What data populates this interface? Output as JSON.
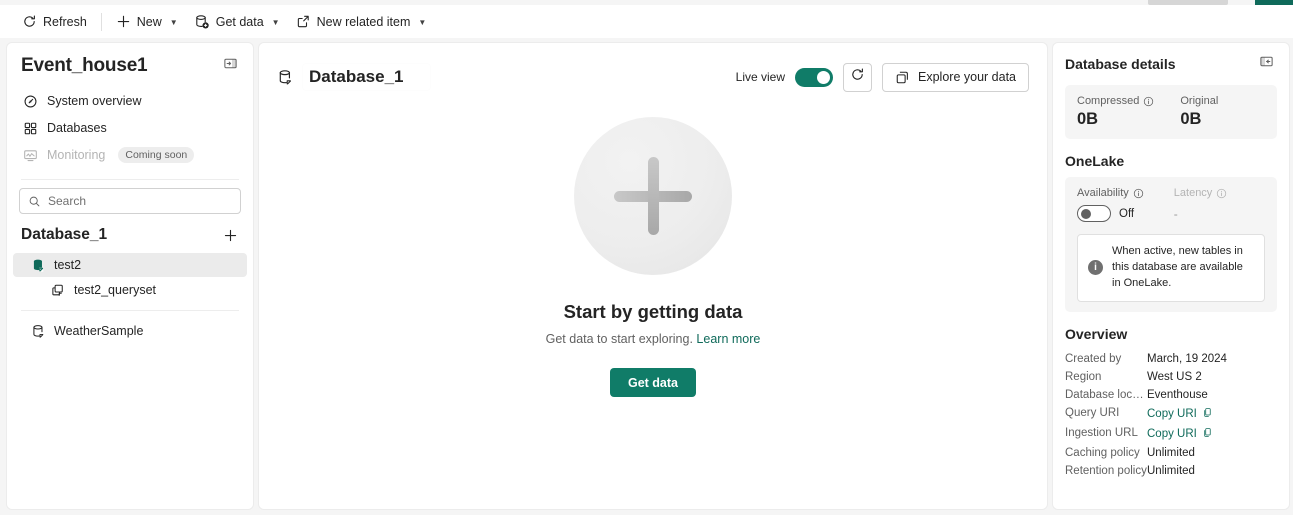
{
  "commandbar": {
    "items": [
      {
        "label": "Refresh",
        "icon": "refresh-icon",
        "chevron": false
      },
      {
        "label": "New",
        "icon": "plus-icon",
        "chevron": true
      },
      {
        "label": "Get data",
        "icon": "get-data-icon",
        "chevron": true
      },
      {
        "label": "New related item",
        "icon": "external-link-icon",
        "chevron": true
      }
    ]
  },
  "sidebar": {
    "title": "Event_house1",
    "collapse_tooltip": "Collapse pane",
    "nav": [
      {
        "label": "System overview",
        "icon": "gauge-icon",
        "disabled": false,
        "badge": ""
      },
      {
        "label": "Databases",
        "icon": "grid-icon",
        "disabled": false,
        "badge": ""
      },
      {
        "label": "Monitoring",
        "icon": "monitor-icon",
        "disabled": true,
        "badge": "Coming soon"
      }
    ],
    "search": {
      "placeholder": "Search",
      "value": ""
    },
    "db_header": "Database_1",
    "add_tooltip": "Add",
    "tree": [
      {
        "label": "test2",
        "icon": "database-icon",
        "selected": true,
        "indent": 0
      },
      {
        "label": "test2_queryset",
        "icon": "queryset-icon",
        "selected": false,
        "indent": 1
      }
    ],
    "tree_footer": [
      {
        "label": "WeatherSample",
        "icon": "database-icon",
        "selected": false,
        "indent": 0
      }
    ]
  },
  "main": {
    "title": "Database_1",
    "title_icon": "database-icon",
    "live_view_label": "Live view",
    "live_view_on": true,
    "refresh_tooltip": "Refresh",
    "explore_label": "Explore your data",
    "explore_icon": "explore-icon",
    "empty": {
      "plus_icon": "plus-icon",
      "title": "Start by getting data",
      "subtitle": "Get data to start exploring.",
      "link": "Learn more",
      "button": "Get data"
    }
  },
  "rightpanel": {
    "title": "Database details",
    "collapse_tooltip": "Collapse pane",
    "stats": [
      {
        "label": "Compressed",
        "info": true,
        "value": "0B"
      },
      {
        "label": "Original",
        "info": false,
        "value": "0B"
      }
    ],
    "onelake": {
      "section_title": "OneLake",
      "availability_label": "Availability",
      "availability_state": "Off",
      "availability_on": false,
      "latency_label": "Latency",
      "latency_value": "-",
      "note": "When active, new tables in this database are available in OneLake."
    },
    "overview": {
      "section_title": "Overview",
      "rows": [
        {
          "key": "Created by",
          "value": "March, 19 2024",
          "type": "text"
        },
        {
          "key": "Region",
          "value": "West US 2",
          "type": "text"
        },
        {
          "key": "Database locati...",
          "value": "Eventhouse",
          "type": "text"
        },
        {
          "key": "Query URI",
          "value": "Copy URI",
          "type": "copy"
        },
        {
          "key": "Ingestion URL",
          "value": "Copy URI",
          "type": "copy"
        },
        {
          "key": "Caching policy",
          "value": "Unlimited",
          "type": "text"
        },
        {
          "key": "Retention policy",
          "value": "Unlimited",
          "type": "text"
        }
      ]
    }
  },
  "colors": {
    "accent_teal": "#107c68",
    "link_teal": "#0f6a5a",
    "page_bg": "#f5f5f5",
    "panel_bg": "#ffffff"
  }
}
